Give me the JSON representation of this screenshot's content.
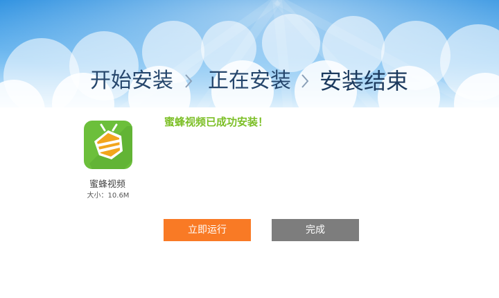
{
  "steps": {
    "step1": "开始安装",
    "step2": "正在安装",
    "step3": "安装结束"
  },
  "icons": {
    "separator": "chevron-right-icon",
    "app": "bee-video-app-icon"
  },
  "app": {
    "name": "蜜蜂视频",
    "size": "大小：10.6M"
  },
  "message": {
    "success": "蜜蜂视频已成功安装！"
  },
  "buttons": {
    "run": "立即运行",
    "done": "完成"
  },
  "colors": {
    "sky_top": "#2a8fe0",
    "sky_bottom": "#ffffff",
    "success_text": "#7cbf26",
    "run_button": "#f97a25",
    "done_button": "#7d7d7d",
    "app_icon_bg": "#6cbf3b",
    "app_icon_stripe": "#f2a51c"
  }
}
